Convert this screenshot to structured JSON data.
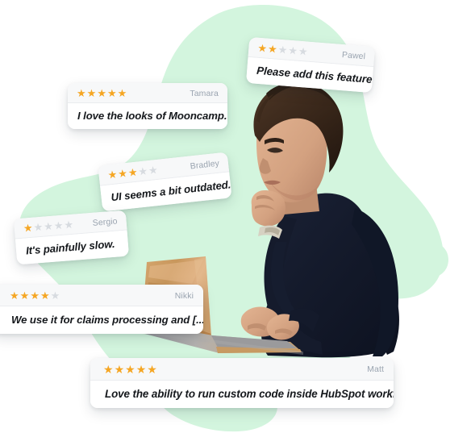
{
  "illustration": {
    "title": "Customer review cards over photo of man using laptop",
    "background_color": "#ffffff",
    "blob_color": "#d3f5de",
    "star_filled_color": "#f5a623",
    "star_empty_color": "#d7dbe0",
    "reviewer_name_color": "#9aa4b0",
    "card_background": "#ffffff",
    "card_header_background": "#f7f8f9",
    "quote_text_color": "#15181c",
    "star_glyph": "★",
    "max_stars": 5
  },
  "photo": {
    "subject": "man-at-laptop",
    "sweater_color": "#161c2d",
    "hair_color": "#3a2a1d",
    "skin_color": "#d8a386",
    "laptop_lid_color": "#c8945a",
    "laptop_base_color": "#cfa06a",
    "watch_color": "#d8d3c4"
  },
  "reviews": [
    {
      "id": "pawel",
      "reviewer": "Pawel",
      "rating": 2,
      "quote": "Please add this feature!"
    },
    {
      "id": "tamara",
      "reviewer": "Tamara",
      "rating": 5,
      "quote": "I love the looks of Mooncamp."
    },
    {
      "id": "bradley",
      "reviewer": "Bradley",
      "rating": 3,
      "quote": "UI seems a bit outdated."
    },
    {
      "id": "sergio",
      "reviewer": "Sergio",
      "rating": 1,
      "quote": "It's painfully slow."
    },
    {
      "id": "nikki",
      "reviewer": "Nikki",
      "rating": 4,
      "quote": "We use it for claims processing and [...]"
    },
    {
      "id": "matt",
      "reviewer": "Matt",
      "rating": 5,
      "quote": "Love the ability to run custom code inside HubSpot workflows."
    }
  ]
}
